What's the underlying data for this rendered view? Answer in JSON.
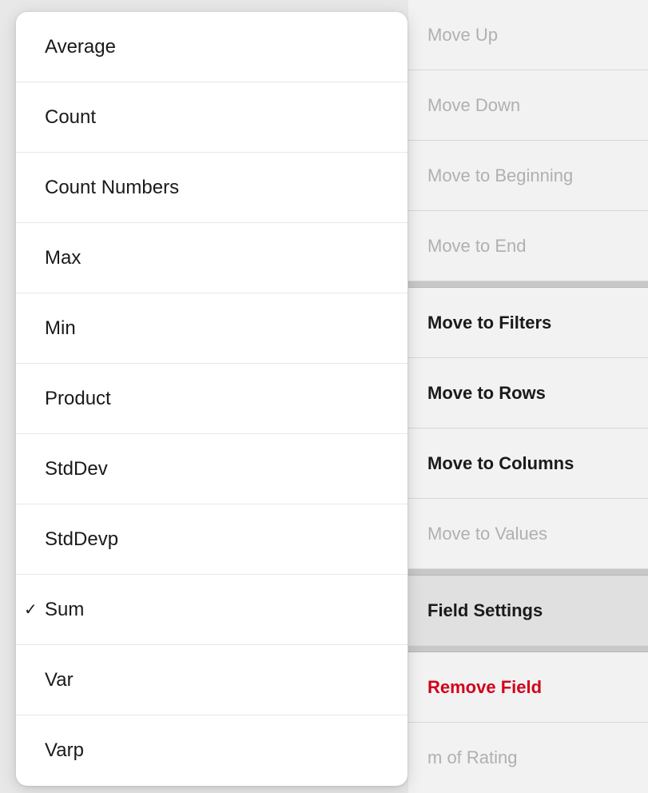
{
  "rightMenu": {
    "items": [
      {
        "id": "move-up",
        "label": "Move Up",
        "state": "disabled",
        "bold": false,
        "red": false
      },
      {
        "id": "move-down",
        "label": "Move Down",
        "state": "disabled",
        "bold": false,
        "red": false
      },
      {
        "id": "move-to-beginning",
        "label": "Move to Beginning",
        "state": "disabled",
        "bold": false,
        "red": false
      },
      {
        "id": "move-to-end",
        "label": "Move to End",
        "state": "disabled",
        "bold": false,
        "red": false
      },
      {
        "id": "separator1",
        "type": "separator"
      },
      {
        "id": "move-to-filters",
        "label": "Move to Filters",
        "state": "normal",
        "bold": true,
        "red": false
      },
      {
        "id": "move-to-rows",
        "label": "Move to Rows",
        "state": "normal",
        "bold": true,
        "red": false
      },
      {
        "id": "move-to-columns",
        "label": "Move to Columns",
        "state": "normal",
        "bold": true,
        "red": false
      },
      {
        "id": "move-to-values",
        "label": "Move to Values",
        "state": "disabled",
        "bold": false,
        "red": false
      },
      {
        "id": "separator2",
        "type": "separator"
      },
      {
        "id": "field-settings",
        "label": "Field Settings",
        "state": "active",
        "bold": true,
        "red": false
      },
      {
        "id": "separator3",
        "type": "separator"
      },
      {
        "id": "remove-field",
        "label": "Remove Field",
        "state": "normal",
        "bold": false,
        "red": true
      }
    ],
    "bottomText": "m of Rating"
  },
  "leftMenu": {
    "items": [
      {
        "id": "average",
        "label": "Average",
        "checked": false
      },
      {
        "id": "count",
        "label": "Count",
        "checked": false
      },
      {
        "id": "count-numbers",
        "label": "Count Numbers",
        "checked": false
      },
      {
        "id": "max",
        "label": "Max",
        "checked": false
      },
      {
        "id": "min",
        "label": "Min",
        "checked": false
      },
      {
        "id": "product",
        "label": "Product",
        "checked": false
      },
      {
        "id": "stddev",
        "label": "StdDev",
        "checked": false
      },
      {
        "id": "stddevp",
        "label": "StdDevp",
        "checked": false
      },
      {
        "id": "sum",
        "label": "Sum",
        "checked": true
      },
      {
        "id": "var",
        "label": "Var",
        "checked": false
      },
      {
        "id": "varp",
        "label": "Varp",
        "checked": false
      }
    ]
  }
}
